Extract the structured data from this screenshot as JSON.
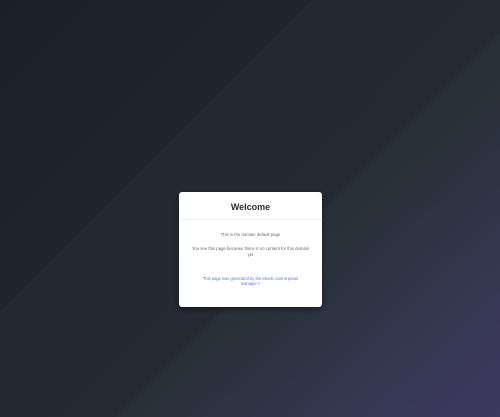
{
  "page": {
    "background_colors": [
      "#1b1f27",
      "#262a34",
      "#2b3540",
      "#4a3e76"
    ]
  },
  "card": {
    "title": "Welcome",
    "message_line": "This is the domain default page",
    "explanation": "You see this page because there is no content for this domain yet",
    "footer_link_text": "This page was generated by the ebook control panel manager",
    "footer_icon": "external-link-icon"
  }
}
